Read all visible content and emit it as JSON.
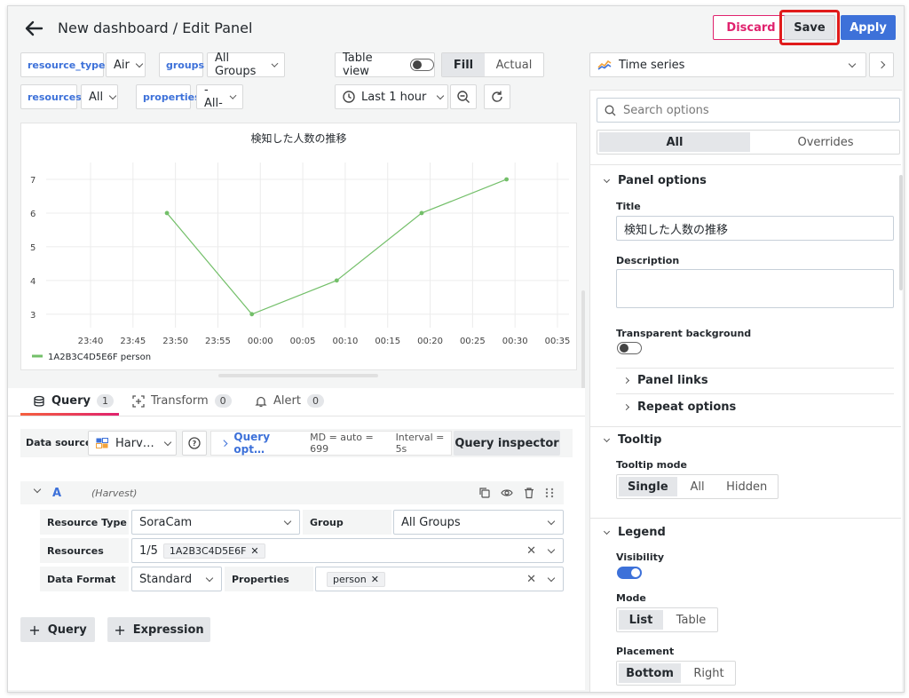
{
  "header": {
    "title": "New dashboard / Edit Panel",
    "discard_label": "Discard",
    "save_label": "Save",
    "apply_label": "Apply"
  },
  "variables": {
    "resource_types": {
      "label": "resource_types",
      "value": "Air"
    },
    "groups": {
      "label": "groups",
      "value": "All Groups"
    },
    "resources": {
      "label": "resources",
      "value": "All"
    },
    "properties": {
      "label": "properties",
      "value": "-All-"
    }
  },
  "toolbar": {
    "table_view_label": "Table view",
    "fill_label": "Fill",
    "actual_label": "Actual",
    "time_range": "Last 1 hour"
  },
  "chart_data": {
    "type": "line",
    "title": "検知した人数の推移",
    "x_ticks": [
      "23:40",
      "23:45",
      "23:50",
      "23:55",
      "00:00",
      "00:05",
      "00:10",
      "00:15",
      "00:20",
      "00:25",
      "00:30",
      "00:35"
    ],
    "y_ticks": [
      "7",
      "6",
      "5",
      "4",
      "3"
    ],
    "ylim": [
      2.6,
      7.5
    ],
    "series": [
      {
        "name": "1A2B3C4D5E6F person",
        "color": "#73bf69",
        "x": [
          "23:49",
          "23:59",
          "00:09",
          "00:19",
          "00:29"
        ],
        "y": [
          6,
          3,
          4,
          6,
          7
        ]
      }
    ]
  },
  "query_tabs": [
    {
      "label": "Query",
      "count": "1"
    },
    {
      "label": "Transform",
      "count": "0"
    },
    {
      "label": "Alert",
      "count": "0"
    }
  ],
  "datasource": {
    "label": "Data source",
    "value": "Harv…",
    "query_options_label": "Query opt…",
    "md": "MD = auto = 699",
    "interval": "Interval = 5s",
    "inspector_label": "Query inspector"
  },
  "query": {
    "ref_id": "A",
    "source": "(Harvest)",
    "resource_type_label": "Resource Type",
    "resource_type_value": "SoraCam",
    "group_label": "Group",
    "group_value": "All Groups",
    "resources_label": "Resources",
    "resources_count": "1/5",
    "resources_tag": "1A2B3C4D5E6F",
    "data_format_label": "Data Format",
    "data_format_value": "Standard",
    "properties_label": "Properties",
    "properties_tag": "person"
  },
  "bottom_buttons": {
    "query": "Query",
    "expression": "Expression"
  },
  "options": {
    "visualization": "Time series",
    "search_placeholder": "Search options",
    "tab_all": "All",
    "tab_overrides": "Overrides",
    "panel_options": {
      "title": "Panel options",
      "title_label": "Title",
      "title_value": "検知した人数の推移",
      "description_label": "Description",
      "transparent_label": "Transparent background",
      "panel_links": "Panel links",
      "repeat_options": "Repeat options"
    },
    "tooltip": {
      "title": "Tooltip",
      "mode_label": "Tooltip mode",
      "modes": [
        "Single",
        "All",
        "Hidden"
      ]
    },
    "legend": {
      "title": "Legend",
      "visibility_label": "Visibility",
      "mode_label": "Mode",
      "modes": [
        "List",
        "Table"
      ],
      "placement_label": "Placement",
      "placements": [
        "Bottom",
        "Right"
      ]
    }
  }
}
